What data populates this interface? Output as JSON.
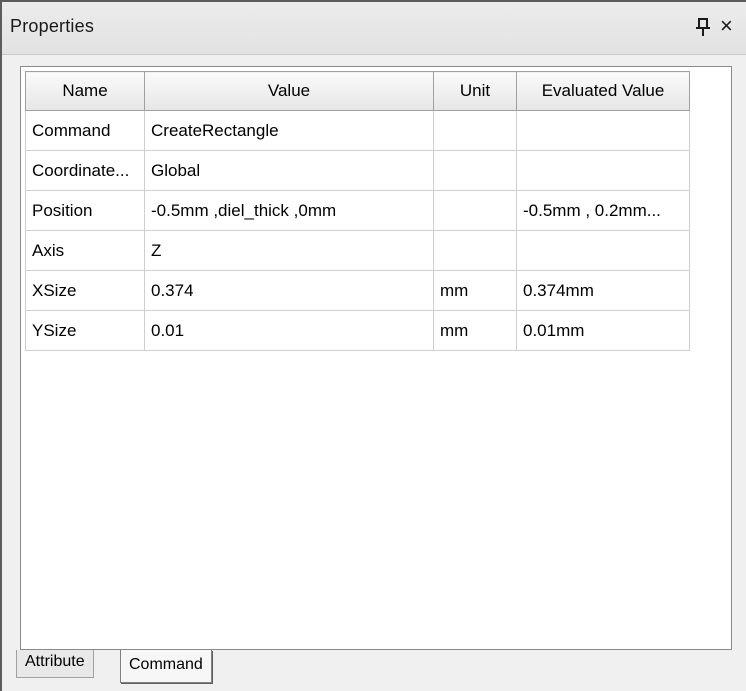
{
  "panel": {
    "title": "Properties",
    "pin_glyph": "ք",
    "close_glyph": "×",
    "icons": {
      "pin": "pin-icon",
      "close": "close-icon"
    }
  },
  "table": {
    "headers": [
      "Name",
      "Value",
      "Unit",
      "Evaluated Value"
    ],
    "rows": [
      {
        "name": "Command",
        "value": "CreateRectangle",
        "unit": "",
        "evaluated": ""
      },
      {
        "name": "Coordinate...",
        "value": "Global",
        "unit": "",
        "evaluated": ""
      },
      {
        "name": "Position",
        "value": "-0.5mm ,diel_thick ,0mm",
        "unit": "",
        "evaluated": "-0.5mm , 0.2mm..."
      },
      {
        "name": "Axis",
        "value": "Z",
        "unit": "",
        "evaluated": ""
      },
      {
        "name": "XSize",
        "value": "0.374",
        "unit": "mm",
        "evaluated": "0.374mm"
      },
      {
        "name": "YSize",
        "value": "0.01",
        "unit": "mm",
        "evaluated": "0.01mm"
      }
    ]
  },
  "tabs": [
    {
      "label": "Attribute",
      "active": false
    },
    {
      "label": "Command",
      "active": true
    }
  ]
}
